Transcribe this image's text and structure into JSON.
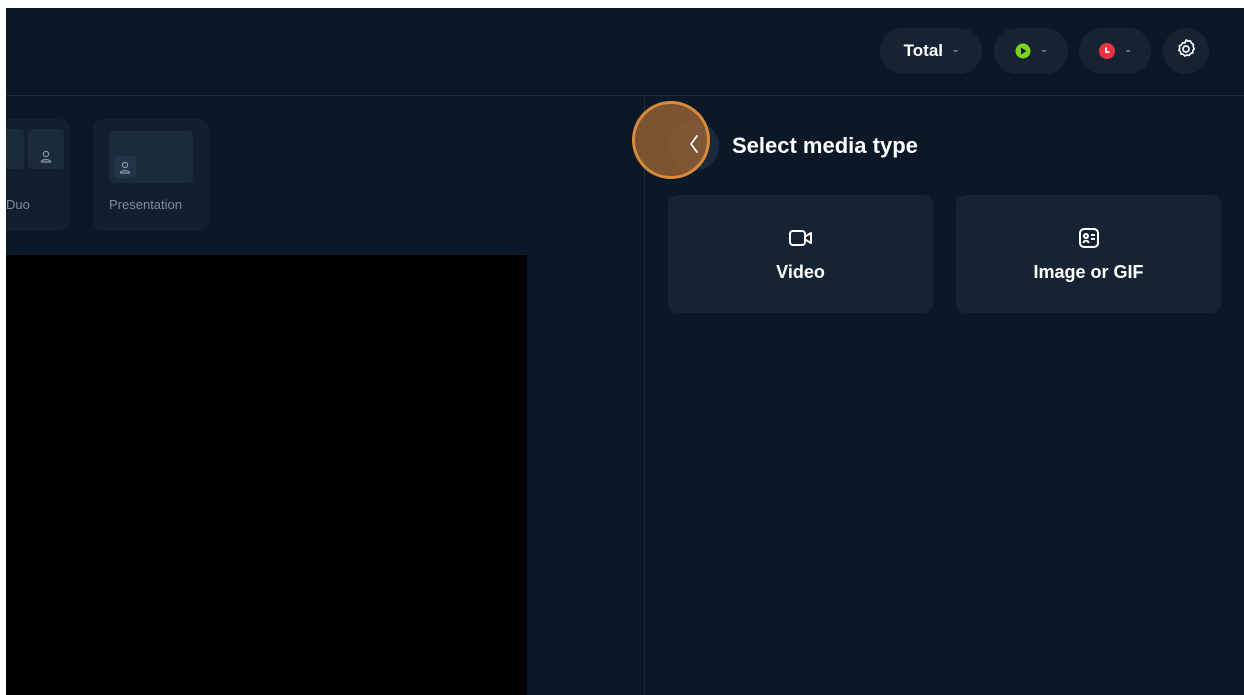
{
  "topbar": {
    "total_label": "Total",
    "total_value": "-",
    "live_value": "-",
    "rec_value": "-",
    "live_icon": "play-icon",
    "rec_icon": "record-clock-icon",
    "settings_icon": "gear-icon",
    "colors": {
      "live": "#7ed321",
      "rec": "#e8323c"
    }
  },
  "layouts": {
    "items": [
      {
        "label": "Duo"
      },
      {
        "label": "Presentation"
      }
    ]
  },
  "panel": {
    "title": "Select media type",
    "back_icon": "chevron-left-icon",
    "media_types": [
      {
        "label": "Video",
        "icon": "video-camera-icon"
      },
      {
        "label": "Image or GIF",
        "icon": "image-card-icon"
      }
    ]
  }
}
